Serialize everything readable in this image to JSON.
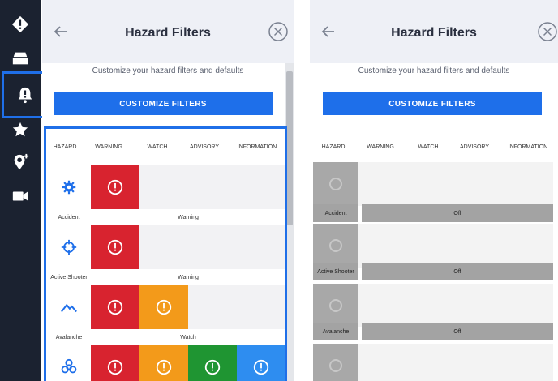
{
  "rail": {
    "items": [
      {
        "icon": "diamond-alert-icon"
      },
      {
        "icon": "layers-icon"
      },
      {
        "icon": "hazard-bell-icon",
        "active": true
      },
      {
        "icon": "star-icon"
      },
      {
        "icon": "map-pin-plus-icon"
      },
      {
        "icon": "video-camera-icon"
      }
    ]
  },
  "left_panel": {
    "title": "Hazard Filters",
    "subtitle": "Customize your hazard filters and defaults",
    "button": "CUSTOMIZE FILTERS",
    "columns": [
      "HAZARD",
      "WARNING",
      "WATCH",
      "ADVISORY",
      "INFORMATION"
    ],
    "rows": [
      {
        "hazard": "Accident",
        "icon": "gear-icon",
        "level": "Warning",
        "cells": [
          "warning",
          "off",
          "off",
          "off"
        ]
      },
      {
        "hazard": "Active Shooter",
        "icon": "crosshair-icon",
        "level": "Warning",
        "cells": [
          "warning",
          "off",
          "off",
          "off"
        ]
      },
      {
        "hazard": "Avalanche",
        "icon": "mountain-icon",
        "level": "Watch",
        "cells": [
          "warning",
          "watch",
          "off",
          "off"
        ]
      },
      {
        "hazard": "",
        "icon": "biohazard-icon",
        "level": "",
        "cells": [
          "warning",
          "watch",
          "advisory",
          "info"
        ]
      }
    ]
  },
  "right_panel": {
    "title": "Hazard Filters",
    "subtitle": "Customize your hazard filters and defaults",
    "button": "CUSTOMIZE FILTERS",
    "columns": [
      "HAZARD",
      "WARNING",
      "WATCH",
      "ADVISORY",
      "INFORMATION"
    ],
    "rows": [
      {
        "hazard": "Accident",
        "level": "Off"
      },
      {
        "hazard": "Active Shooter",
        "level": "Off"
      },
      {
        "hazard": "Avalanche",
        "level": "Off"
      }
    ]
  },
  "colors": {
    "rail_bg": "#1b2230",
    "accent": "#1e6fea",
    "warning": "#d8232f",
    "watch": "#f39a1a",
    "advisory": "#1f9532",
    "information": "#2e8df0",
    "disabled": "#a8a8a8"
  }
}
